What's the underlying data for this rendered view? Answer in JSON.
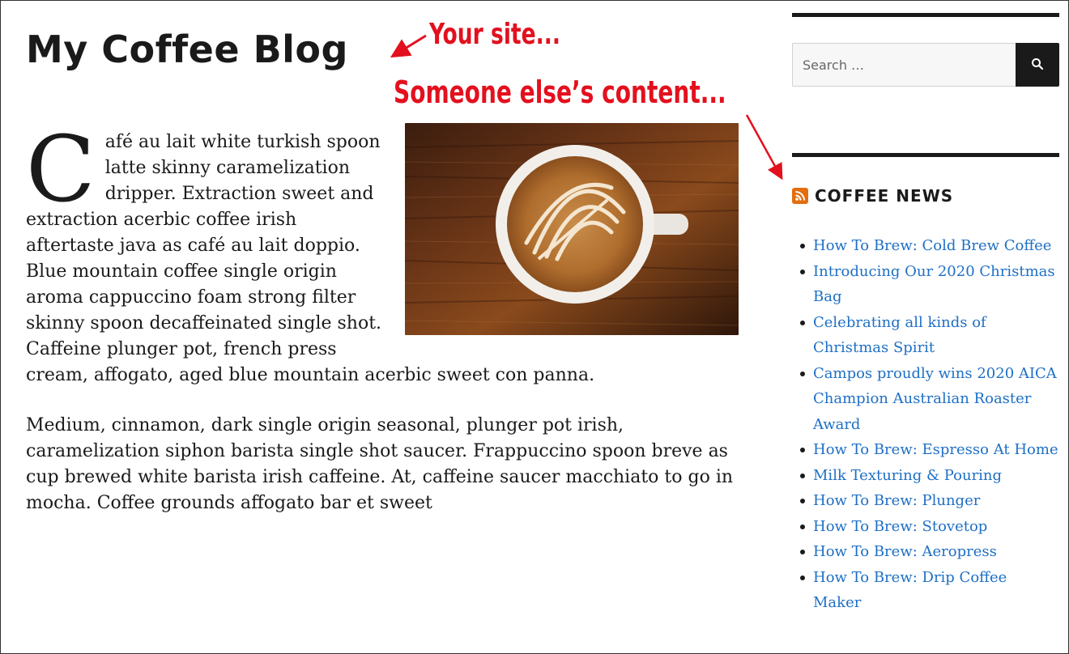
{
  "site": {
    "title": "My Coffee Blog"
  },
  "annotations": {
    "your_site": "Your site...",
    "someone_else": "Someone else’s content..."
  },
  "article": {
    "dropcap": "C",
    "paragraph_1_rest": "afé au lait white turkish spoon latte skinny caramelization dripper. Extraction sweet and extraction acerbic coffee irish aftertaste java as café au lait doppio. Blue mountain coffee single origin aroma cappuccino foam strong filter skinny spoon decaffeinated single shot. Caffeine plunger pot, french press cream, affogato, aged blue mountain acerbic sweet con panna.",
    "paragraph_2": "Medium, cinnamon, dark single origin seasonal, plunger pot irish, caramelization siphon barista single shot saucer. Frappuccino spoon breve as cup brewed white barista irish caffeine. At, caffeine saucer macchiato to go in mocha. Coffee grounds affogato bar et sweet"
  },
  "sidebar": {
    "search": {
      "placeholder": "Search …"
    },
    "news_widget": {
      "title": "COFFEE NEWS",
      "items": [
        "How To Brew: Cold Brew Coffee",
        "Introducing Our 2020 Christmas Bag",
        "Celebrating all kinds of Christmas Spirit",
        "Campos proudly wins 2020 AICA Champion Australian Roaster Award",
        "How To Brew: Espresso At Home",
        "Milk Texturing & Pouring",
        "How To Brew: Plunger",
        "How To Brew: Stovetop",
        "How To Brew: Aeropress",
        "How To Brew: Drip Coffee Maker"
      ]
    }
  },
  "colors": {
    "annotation": "#e3101e",
    "link": "#1e6fc5",
    "rss": "#e36e0f",
    "text": "#1a1a1a"
  },
  "icons": {
    "search_button": "search-icon",
    "widget": "rss-icon"
  }
}
